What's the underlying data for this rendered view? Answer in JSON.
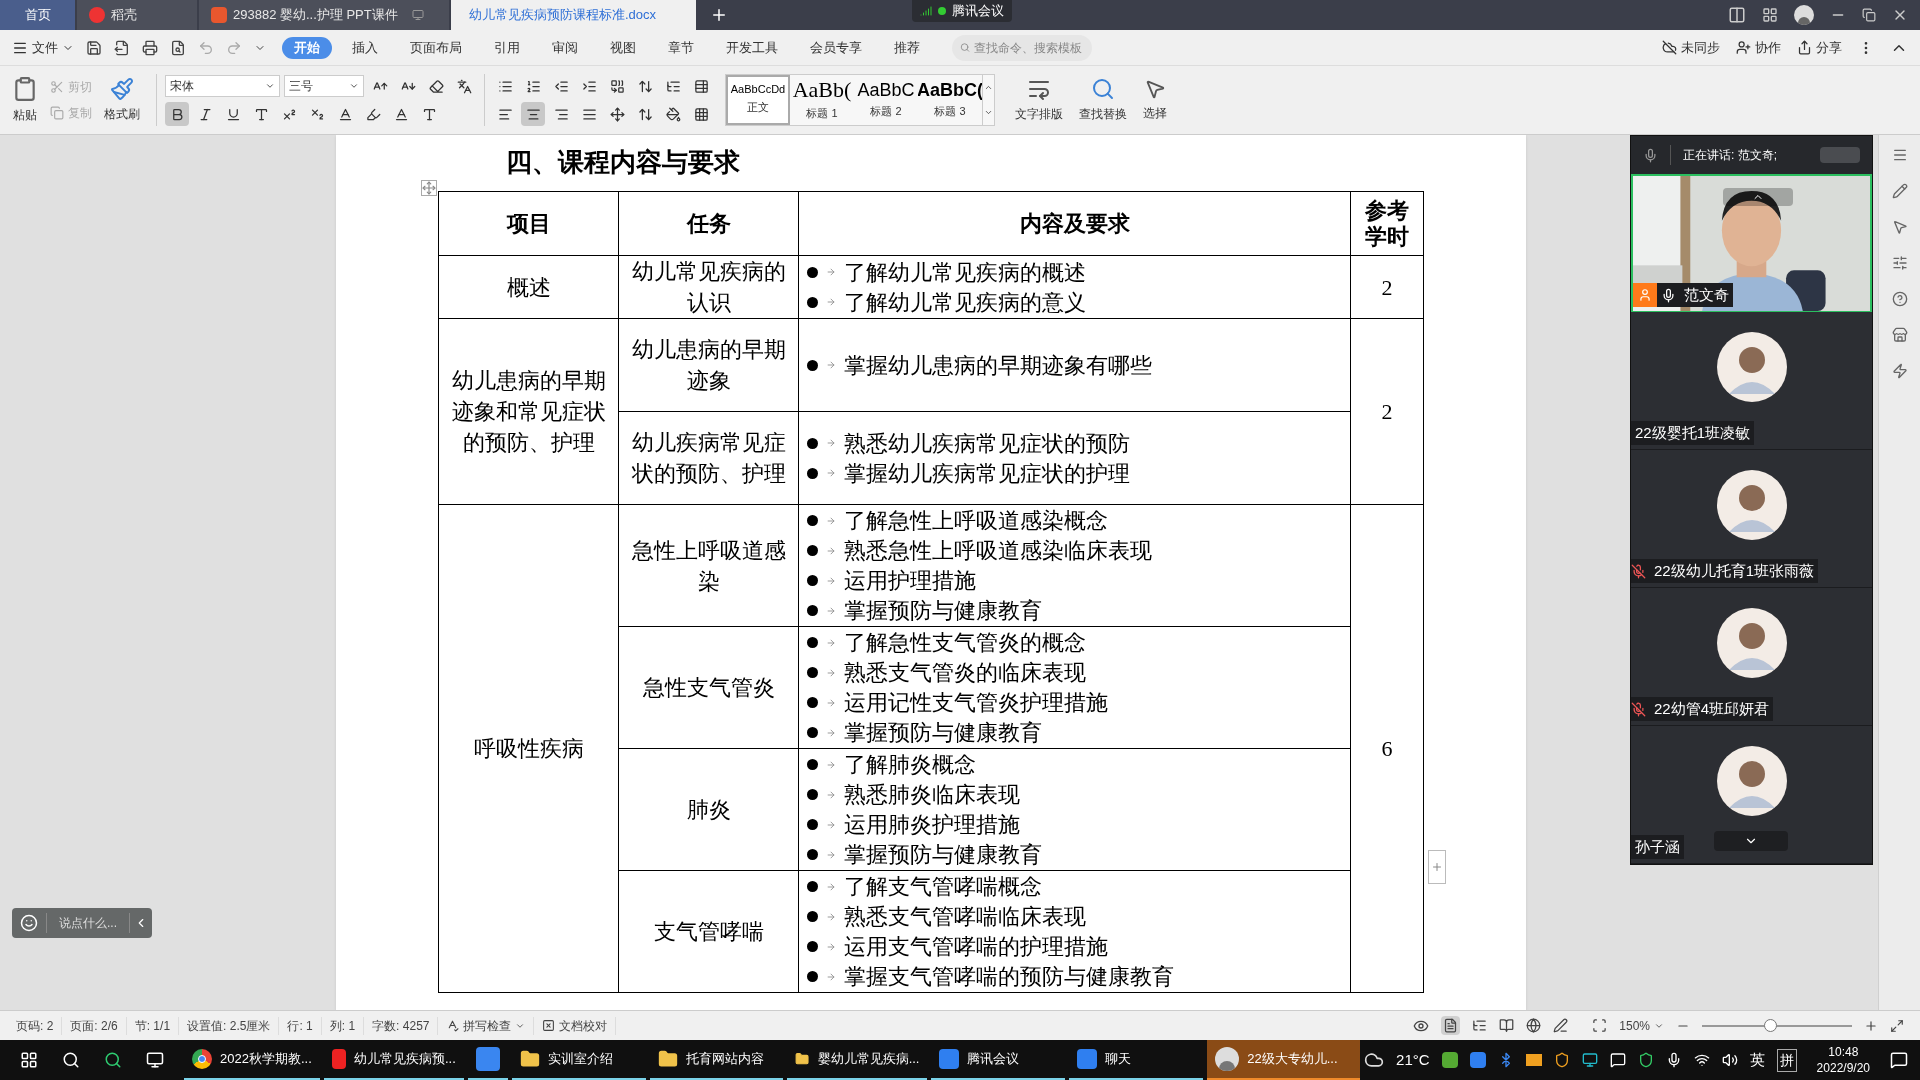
{
  "tabs": [
    {
      "label": "首页",
      "kind": "home",
      "selected": false
    },
    {
      "label": "稻壳",
      "kind": "docer",
      "selected": false
    },
    {
      "label": "293882 婴幼...护理  PPT课件",
      "kind": "ppt",
      "selected": false
    },
    {
      "label": "幼儿常见疾病预防课程标准.docx",
      "kind": "doc",
      "selected": true
    }
  ],
  "meeting_badge": "腾讯会议",
  "menu": {
    "file": "文件",
    "tabs": [
      {
        "label": "开始",
        "selected": true
      },
      {
        "label": "插入",
        "selected": false
      },
      {
        "label": "页面布局",
        "selected": false
      },
      {
        "label": "引用",
        "selected": false
      },
      {
        "label": "审阅",
        "selected": false
      },
      {
        "label": "视图",
        "selected": false
      },
      {
        "label": "章节",
        "selected": false
      },
      {
        "label": "开发工具",
        "selected": false
      },
      {
        "label": "会员专享",
        "selected": false
      },
      {
        "label": "推荐",
        "selected": false
      }
    ],
    "search": {
      "placeholder": "查找命令、搜索模板"
    },
    "actions": [
      "未同步",
      "协作",
      "分享"
    ]
  },
  "ribbon": {
    "paste": "粘贴",
    "cut": {
      "label": "剪切",
      "disabled": true
    },
    "copy": {
      "label": "复制",
      "disabled": true
    },
    "format_painter": "格式刷",
    "font": "宋体",
    "size": "三号",
    "bold": true,
    "align_center": true,
    "styles": [
      {
        "sample": "AaBbCcDd",
        "label": "正文",
        "selected": true,
        "kind": "body"
      },
      {
        "sample": "AaBb(",
        "label": "标题 1",
        "selected": false,
        "kind": "h1"
      },
      {
        "sample": "AaBbC",
        "label": "标题 2",
        "selected": false,
        "kind": "h2"
      },
      {
        "sample": "AaBbC(",
        "label": "标题 3",
        "selected": false,
        "kind": "h3"
      }
    ],
    "tools": [
      {
        "label": "文字排版",
        "kind": "layout"
      },
      {
        "label": "查找替换",
        "kind": "find"
      },
      {
        "label": "选择",
        "kind": "select"
      }
    ]
  },
  "document": {
    "heading": "四、课程内容与要求",
    "columns": [
      "项目",
      "任务",
      "内容及要求",
      "参考学时"
    ],
    "groups": [
      {
        "item": "概述",
        "hours": "2",
        "tasks": [
          {
            "task": "幼儿常见疾病的认识",
            "points": [
              "了解幼儿常见疾病的概述",
              "了解幼儿常见疾病的意义"
            ]
          }
        ]
      },
      {
        "item": "幼儿患病的早期迹象和常见症状的预防、护理",
        "hours": "2",
        "tasks": [
          {
            "task": "幼儿患病的早期迹象",
            "points": [
              "掌握幼儿患病的早期迹象有哪些"
            ]
          },
          {
            "task": "幼儿疾病常见症状的预防、护理",
            "points": [
              "熟悉幼儿疾病常见症状的预防",
              "掌握幼儿疾病常见症状的护理"
            ]
          }
        ]
      },
      {
        "item": "呼吸性疾病",
        "hours": "6",
        "tasks": [
          {
            "task": "急性上呼吸道感染",
            "points": [
              "了解急性上呼吸道感染概念",
              "熟悉急性上呼吸道感染临床表现",
              "运用护理措施",
              "掌握预防与健康教育"
            ]
          },
          {
            "task": "急性支气管炎",
            "points": [
              "了解急性支气管炎的概念",
              "熟悉支气管炎的临床表现",
              "运用记性支气管炎护理措施",
              "掌握预防与健康教育"
            ]
          },
          {
            "task": "肺炎",
            "points": [
              "了解肺炎概念",
              "熟悉肺炎临床表现",
              "运用肺炎护理措施",
              "掌握预防与健康教育"
            ]
          },
          {
            "task": "支气管哮喘",
            "points": [
              "了解支气管哮喘概念",
              "熟悉支气管哮喘临床表现",
              "运用支气管哮喘的护理措施",
              "掌握支气管哮喘的预防与健康教育"
            ]
          }
        ]
      }
    ]
  },
  "chat_placeholder": "说点什么...",
  "meeting": {
    "speaking": "正在讲话: 范文奇;",
    "participants": [
      {
        "name": "范文奇",
        "kind": "video",
        "muted": false
      },
      {
        "name": "22级婴托1班凌敏",
        "kind": "avatar"
      },
      {
        "name": "22级幼儿托育1班张雨薇",
        "kind": "avatar",
        "muted": true
      },
      {
        "name": "22幼管4班邱妍君",
        "kind": "avatar",
        "muted": true
      },
      {
        "name": "孙子涵",
        "kind": "avatar"
      }
    ]
  },
  "status_bar": {
    "items": [
      "页码: 2",
      "页面: 2/6",
      "节: 1/1",
      "设置值: 2.5厘米",
      "行: 1",
      "列: 1",
      "字数: 4257"
    ],
    "spell": "拼写检查",
    "proof": "文档校对",
    "zoom": "150%",
    "zoom_slider": {
      "level": 0.45
    }
  },
  "taskbar": {
    "apps": [
      {
        "label": "2022秋学期教...",
        "kind": "chrome",
        "selected": false
      },
      {
        "label": "幼儿常见疾病预...",
        "kind": "wps",
        "selected": false
      },
      {
        "kind": "feather",
        "selected": false
      },
      {
        "label": "实训室介绍",
        "kind": "folder",
        "selected": false
      },
      {
        "label": "托育网站内容",
        "kind": "folder",
        "selected": false
      },
      {
        "label": "婴幼儿常见疾病...",
        "kind": "folder",
        "selected": false
      },
      {
        "label": "腾讯会议",
        "kind": "meeting",
        "selected": false
      },
      {
        "label": "聊天",
        "kind": "meeting",
        "selected": false
      },
      {
        "label": "22级大专幼儿...",
        "kind": "avatar",
        "selected": true
      }
    ],
    "temp": "21°C",
    "ime": "英",
    "ime_mode": "拼",
    "time": "10:48",
    "date": "2022/9/20"
  }
}
